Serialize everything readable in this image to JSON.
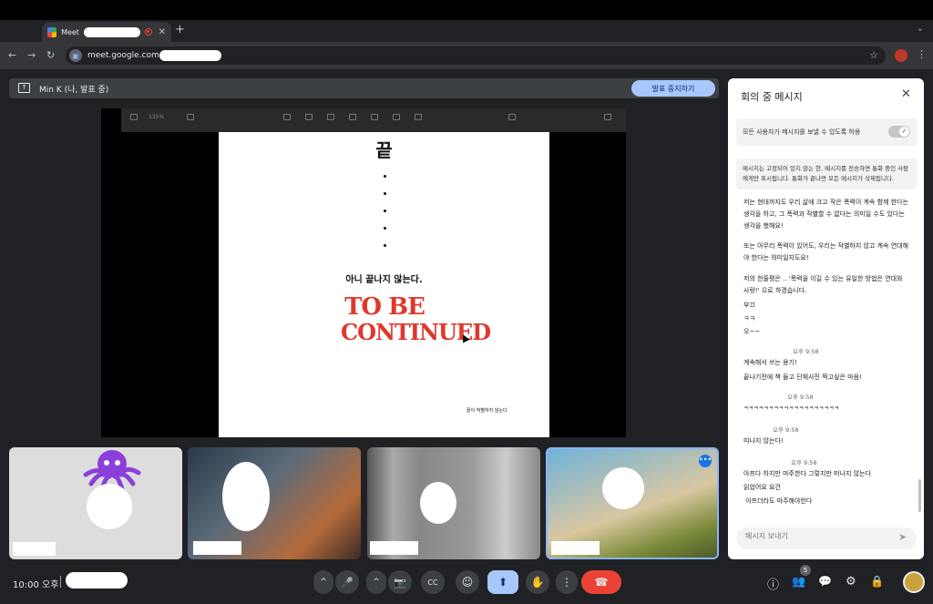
{
  "browser": {
    "tab_title": "Meet",
    "tab_close": "✕",
    "new_tab": "+",
    "url": "meet.google.com"
  },
  "presentation": {
    "presenter_label": "Min K (나, 발표 중)",
    "stop_button": "발표 중지하기",
    "app_zoom": "135%"
  },
  "slide": {
    "heading": "끝",
    "subtitle": "아니 끝나지 않는다.",
    "art_line1": "TO BE",
    "art_line2": "CONTINUED",
    "footer": "끝이 작별하지 않는다"
  },
  "chat": {
    "title": "회의 중 메시지",
    "toggle_label": "모든 사용자가 메시지를 보낼 수 있도록 허용",
    "toggle_on": true,
    "info": "메시지는 고정되어 있지 않는 한, 메시지를 전송하면 통화 중인 사람에게만 표시됩니다. 통화가 끝나면 모든 메시지가 삭제됩니다.",
    "messages": [
      "저는 현대까지도 우리 삶에 크고 작은 폭력이 계속 함께 한다는 생각을 하고, 그 폭력과 작별할 수 없다는 의미일 수도 있다는 생각을 했해요!",
      "또는 아무리 폭력이 있어도, 우리는 작별하지 않고 계속 연대해야 한다는 의미일지도요!",
      "저의 한줄평은 .. '폭력을 이길 수 있는 유일한 방법은 연대와 사랑!' 으로 하겠습니다.",
      "부끄",
      "ㅋㅋ",
      "오~~",
      "오후 9:58",
      "계속해서 쓰는 용기!",
      "끝나기전에 책 들고 단체사진 찍고싶은 마음!",
      "오후 9:58",
      "ㅋㅋㅋㅋㅋㅋㅋㅋㅋㅋㅋㅋㅋㅋㅋㅋㅋㅋㅋ",
      "오후 9:58",
      "띠나지 않는다!",
      "오후 9:58",
      "아프다 하지만 마주한다 그렇지만 떠나지 않는다",
      "읽었어요 요건",
      " 아프더라도 마주해야한다"
    ],
    "input_placeholder": "메시지 보내기"
  },
  "bottom": {
    "time": "10:00 오후",
    "participants_count": "5"
  },
  "icons": {
    "back": "←",
    "forward": "→",
    "reload": "↻",
    "star": "☆",
    "more": "⋮",
    "close": "✕",
    "send": "➤",
    "chevron_up": "^",
    "mic": "🎤",
    "camera": "📷",
    "captions": "CC",
    "emoji": "☺",
    "present": "⬆",
    "hand": "✋",
    "end_call": "☎",
    "info": "ⓘ",
    "people": "👥",
    "chat": "💬",
    "activities": "⚙",
    "lock": "🔒"
  },
  "colors": {
    "accent": "#a8c7fa",
    "end_call": "#ea4335",
    "tile_highlight": "#8ab4f8"
  }
}
